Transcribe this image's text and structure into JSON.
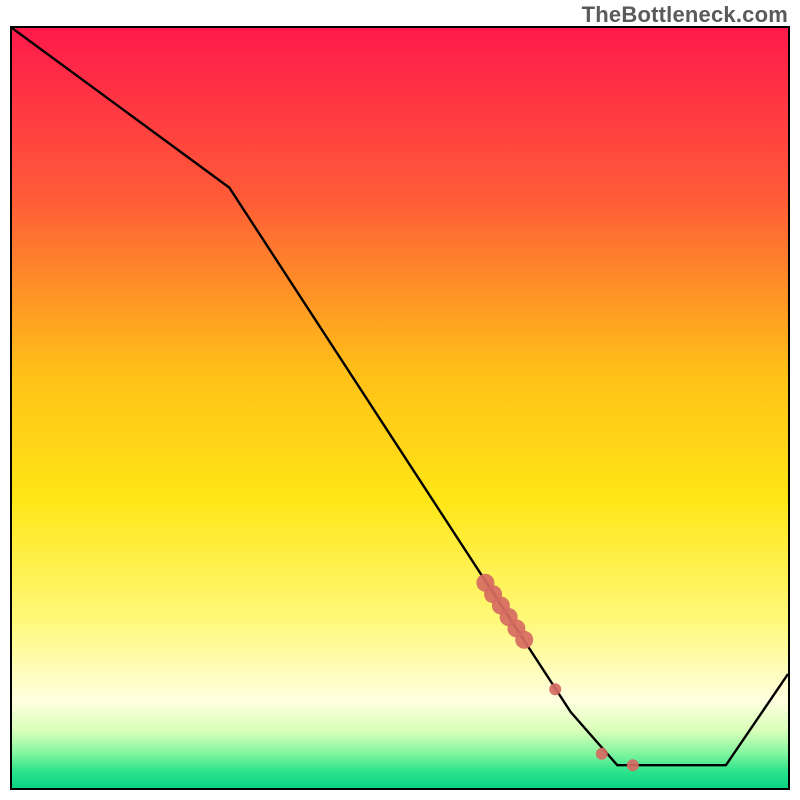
{
  "watermark": "TheBottleneck.com",
  "chart_data": {
    "type": "line",
    "title": "",
    "xlabel": "",
    "ylabel": "",
    "xlim": [
      0,
      100
    ],
    "ylim": [
      0,
      100
    ],
    "grid": false,
    "series": [
      {
        "name": "curve",
        "x": [
          0,
          28,
          72,
          78,
          92,
          100
        ],
        "values": [
          100,
          79,
          10,
          3,
          3,
          15
        ]
      }
    ],
    "scatter": {
      "name": "dots",
      "x": [
        61,
        62,
        63,
        64,
        65,
        66,
        70,
        76,
        80
      ],
      "values": [
        27,
        25.5,
        24,
        22.5,
        21,
        19.5,
        13,
        4.5,
        3
      ],
      "color": "#d66a62",
      "size_big_from_index": 0,
      "size_big_to_index": 5
    },
    "background_gradient": {
      "stops": [
        {
          "offset": 0.0,
          "color": "#ff1a4b"
        },
        {
          "offset": 0.22,
          "color": "#ff5a38"
        },
        {
          "offset": 0.45,
          "color": "#ffbf18"
        },
        {
          "offset": 0.62,
          "color": "#ffe616"
        },
        {
          "offset": 0.78,
          "color": "#fff97a"
        },
        {
          "offset": 0.885,
          "color": "#ffffe0"
        },
        {
          "offset": 0.925,
          "color": "#d8ffb8"
        },
        {
          "offset": 0.955,
          "color": "#80f59f"
        },
        {
          "offset": 0.978,
          "color": "#2de38b"
        },
        {
          "offset": 1.0,
          "color": "#0ad484"
        }
      ]
    }
  }
}
